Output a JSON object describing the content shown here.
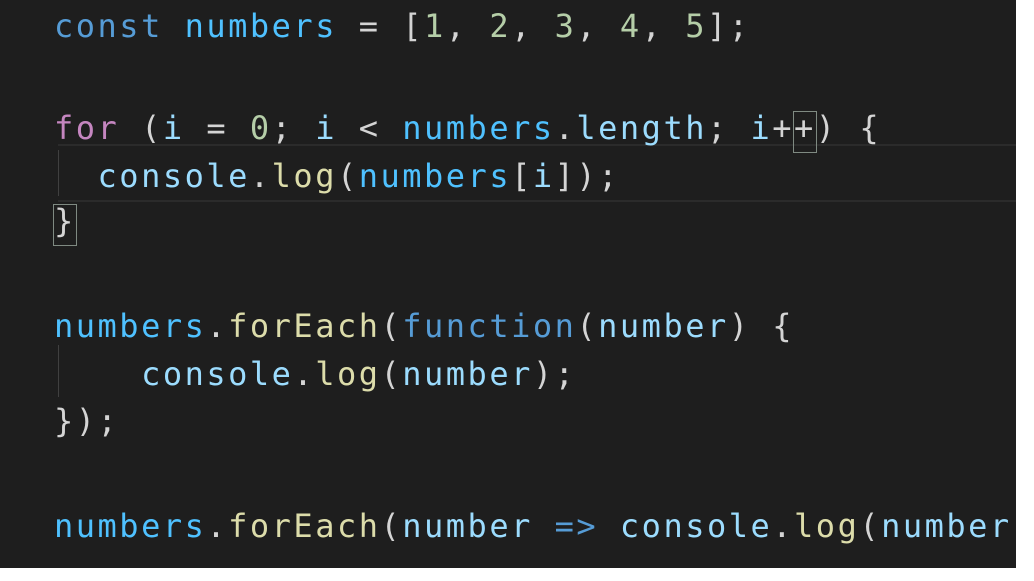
{
  "editor": {
    "theme": {
      "background": "#1e1e1e",
      "keyword": "#569cd6",
      "control": "#c586c0",
      "variable": "#4fc1ff",
      "property": "#9cdcfe",
      "function": "#dcdcaa",
      "number": "#b5cea8",
      "text": "#d4d4d4"
    },
    "lines": [
      {
        "tokens": [
          {
            "t": "const",
            "c": "kw"
          },
          {
            "t": " ",
            "c": "punc"
          },
          {
            "t": "numbers",
            "c": "var"
          },
          {
            "t": " = ",
            "c": "op"
          },
          {
            "t": "[",
            "c": "punc"
          },
          {
            "t": "1",
            "c": "num"
          },
          {
            "t": ", ",
            "c": "punc"
          },
          {
            "t": "2",
            "c": "num"
          },
          {
            "t": ", ",
            "c": "punc"
          },
          {
            "t": "3",
            "c": "num"
          },
          {
            "t": ", ",
            "c": "punc"
          },
          {
            "t": "4",
            "c": "num"
          },
          {
            "t": ", ",
            "c": "punc"
          },
          {
            "t": "5",
            "c": "num"
          },
          {
            "t": "];",
            "c": "punc"
          }
        ]
      },
      {
        "tokens": []
      },
      {
        "tokens": [
          {
            "t": "for",
            "c": "ctrl"
          },
          {
            "t": " (",
            "c": "punc"
          },
          {
            "t": "i",
            "c": "obj"
          },
          {
            "t": " = ",
            "c": "op"
          },
          {
            "t": "0",
            "c": "num"
          },
          {
            "t": "; ",
            "c": "punc"
          },
          {
            "t": "i",
            "c": "obj"
          },
          {
            "t": " < ",
            "c": "op"
          },
          {
            "t": "numbers",
            "c": "var"
          },
          {
            "t": ".",
            "c": "punc"
          },
          {
            "t": "length",
            "c": "obj"
          },
          {
            "t": "; ",
            "c": "punc"
          },
          {
            "t": "i",
            "c": "obj"
          },
          {
            "t": "++",
            "c": "op"
          },
          {
            "t": ") ",
            "c": "punc"
          },
          {
            "t": "{",
            "c": "punc"
          }
        ]
      },
      {
        "tokens": [
          {
            "t": "  ",
            "c": "punc"
          },
          {
            "t": "console",
            "c": "obj"
          },
          {
            "t": ".",
            "c": "punc"
          },
          {
            "t": "log",
            "c": "fn"
          },
          {
            "t": "(",
            "c": "punc"
          },
          {
            "t": "numbers",
            "c": "var"
          },
          {
            "t": "[",
            "c": "punc"
          },
          {
            "t": "i",
            "c": "obj"
          },
          {
            "t": "]);",
            "c": "punc"
          }
        ]
      },
      {
        "tokens": [
          {
            "t": "}",
            "c": "punc"
          }
        ]
      },
      {
        "tokens": []
      },
      {
        "tokens": [
          {
            "t": "numbers",
            "c": "var"
          },
          {
            "t": ".",
            "c": "punc"
          },
          {
            "t": "forEach",
            "c": "fn"
          },
          {
            "t": "(",
            "c": "punc"
          },
          {
            "t": "function",
            "c": "kw"
          },
          {
            "t": "(",
            "c": "punc"
          },
          {
            "t": "number",
            "c": "obj"
          },
          {
            "t": ") {",
            "c": "punc"
          }
        ]
      },
      {
        "tokens": [
          {
            "t": "    ",
            "c": "punc"
          },
          {
            "t": "console",
            "c": "obj"
          },
          {
            "t": ".",
            "c": "punc"
          },
          {
            "t": "log",
            "c": "fn"
          },
          {
            "t": "(",
            "c": "punc"
          },
          {
            "t": "number",
            "c": "obj"
          },
          {
            "t": ");",
            "c": "punc"
          }
        ]
      },
      {
        "tokens": [
          {
            "t": "});",
            "c": "punc"
          }
        ]
      },
      {
        "tokens": []
      },
      {
        "tokens": [
          {
            "t": "numbers",
            "c": "var"
          },
          {
            "t": ".",
            "c": "punc"
          },
          {
            "t": "forEach",
            "c": "fn"
          },
          {
            "t": "(",
            "c": "punc"
          },
          {
            "t": "number",
            "c": "obj"
          },
          {
            "t": " ",
            "c": "punc"
          },
          {
            "t": "=>",
            "c": "kw"
          },
          {
            "t": " ",
            "c": "punc"
          },
          {
            "t": "console",
            "c": "obj"
          },
          {
            "t": ".",
            "c": "punc"
          },
          {
            "t": "log",
            "c": "fn"
          },
          {
            "t": "(",
            "c": "punc"
          },
          {
            "t": "number",
            "c": "obj"
          },
          {
            "t": "));",
            "c": "punc"
          }
        ]
      }
    ]
  }
}
